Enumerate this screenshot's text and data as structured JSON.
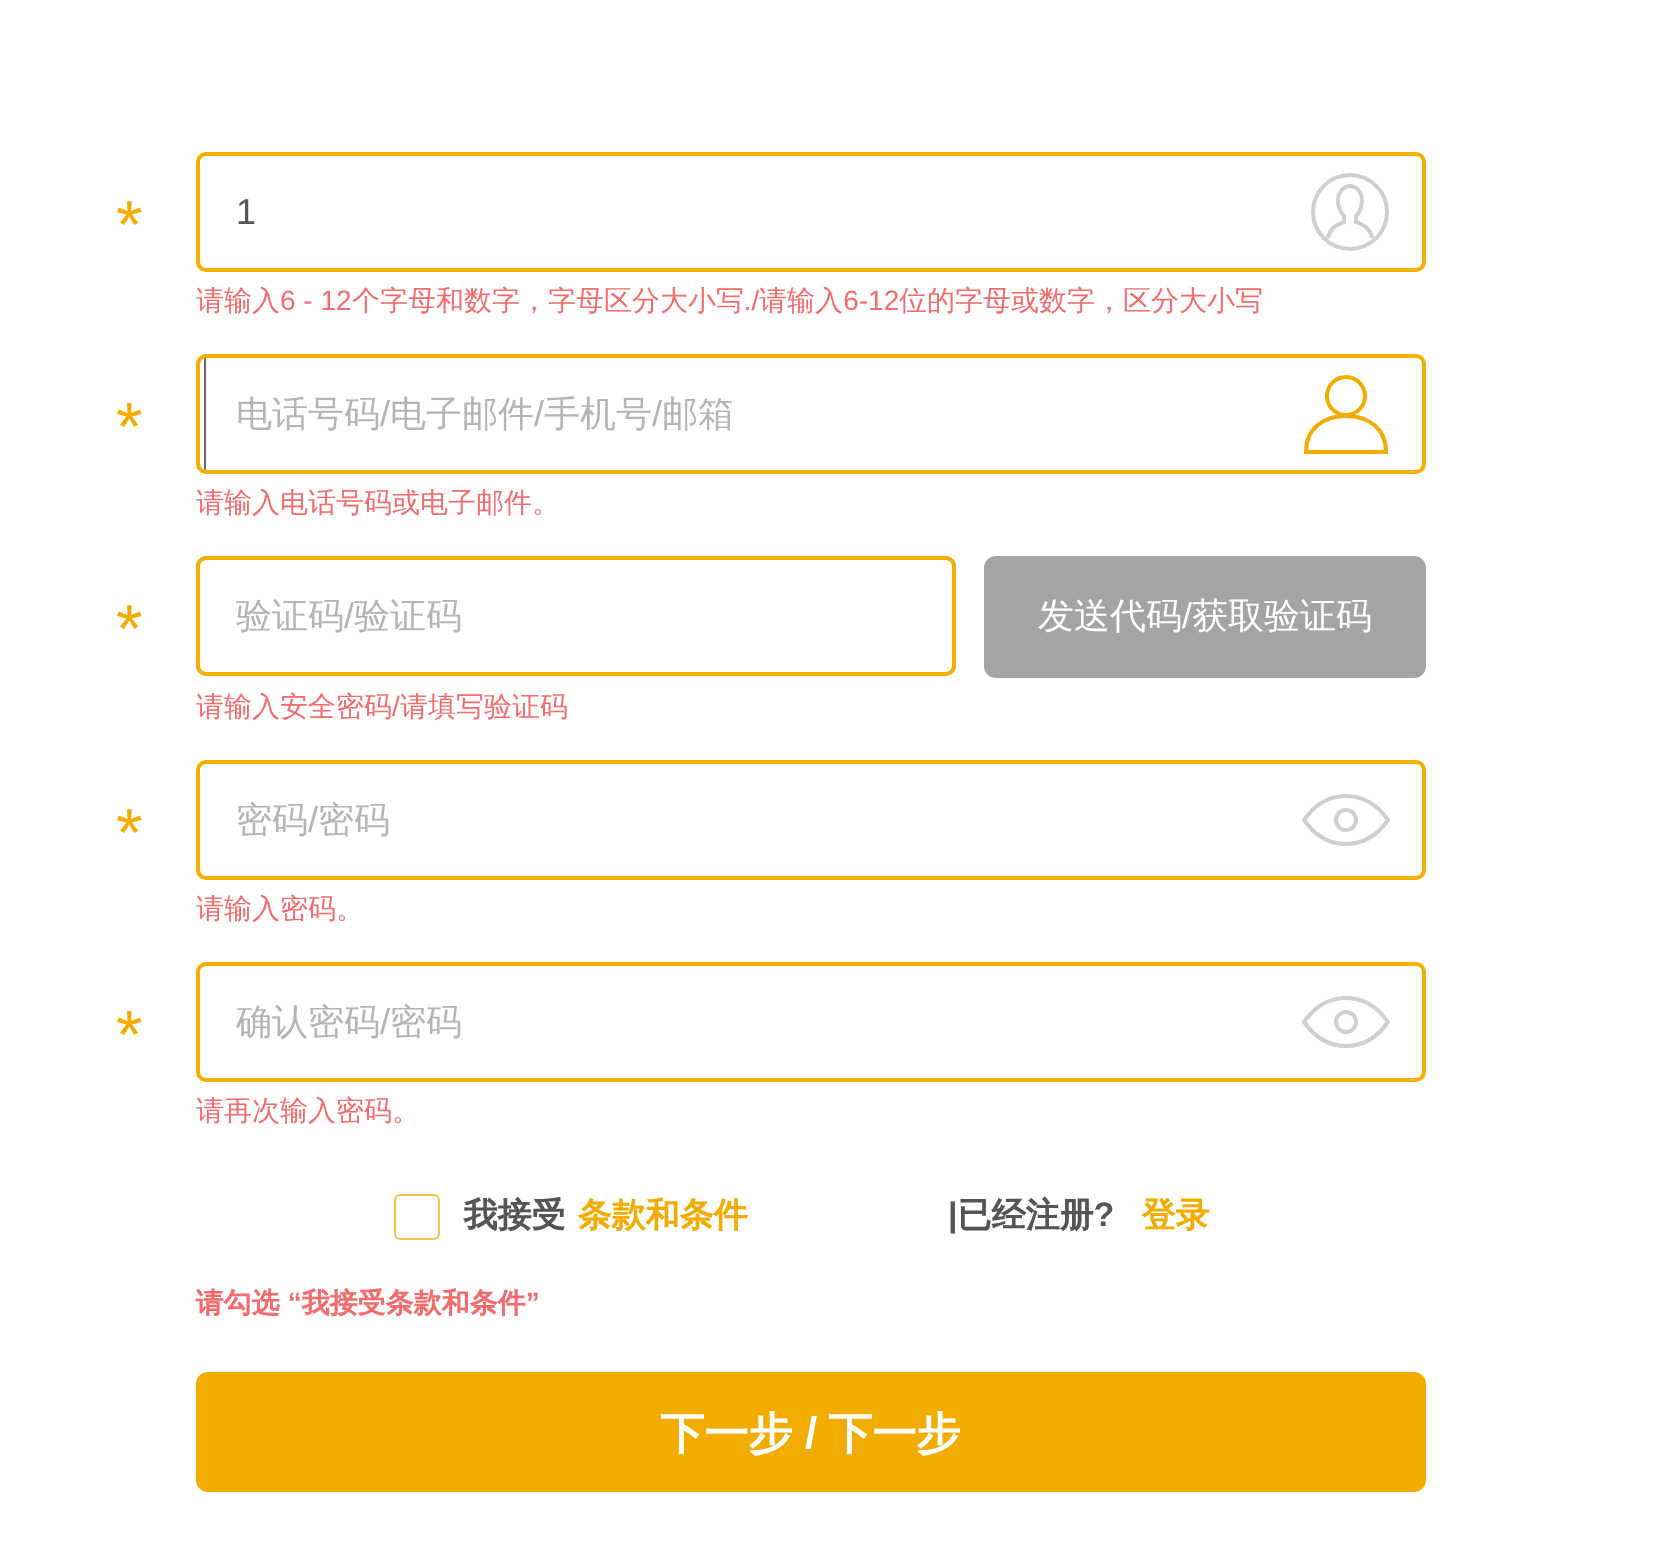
{
  "fields": [
    {
      "marker": "*",
      "kind": "username",
      "value": "1",
      "error": "请输入6 - 12个字母和数字，字母区分大小写./请输入6-12位的字母或数字，区分大小写"
    },
    {
      "marker": "*",
      "kind": "contact",
      "placeholder": "电话号码/电子邮件/手机号/邮箱",
      "focused": true,
      "error": "请输入电话号码或电子邮件。"
    },
    {
      "marker": "*",
      "kind": "code",
      "placeholder": "验证码/验证码",
      "button": {
        "label": "发送代码/获取验证码",
        "disabled": true
      },
      "error": "请输入安全密码/请填写验证码"
    },
    {
      "marker": "*",
      "kind": "password",
      "placeholder": "密码/密码",
      "error": "请输入密码。"
    },
    {
      "marker": "*",
      "kind": "password",
      "placeholder": "确认密码/密码",
      "error": "请再次输入密码。"
    }
  ],
  "terms": {
    "checked": false,
    "label": "我接受",
    "link": "条款和条件",
    "login_prompt": "|已经注册?",
    "login_link": "登录",
    "error": "请勾选 “我接受条款和条件”"
  },
  "submit": "下一步 / 下一步"
}
